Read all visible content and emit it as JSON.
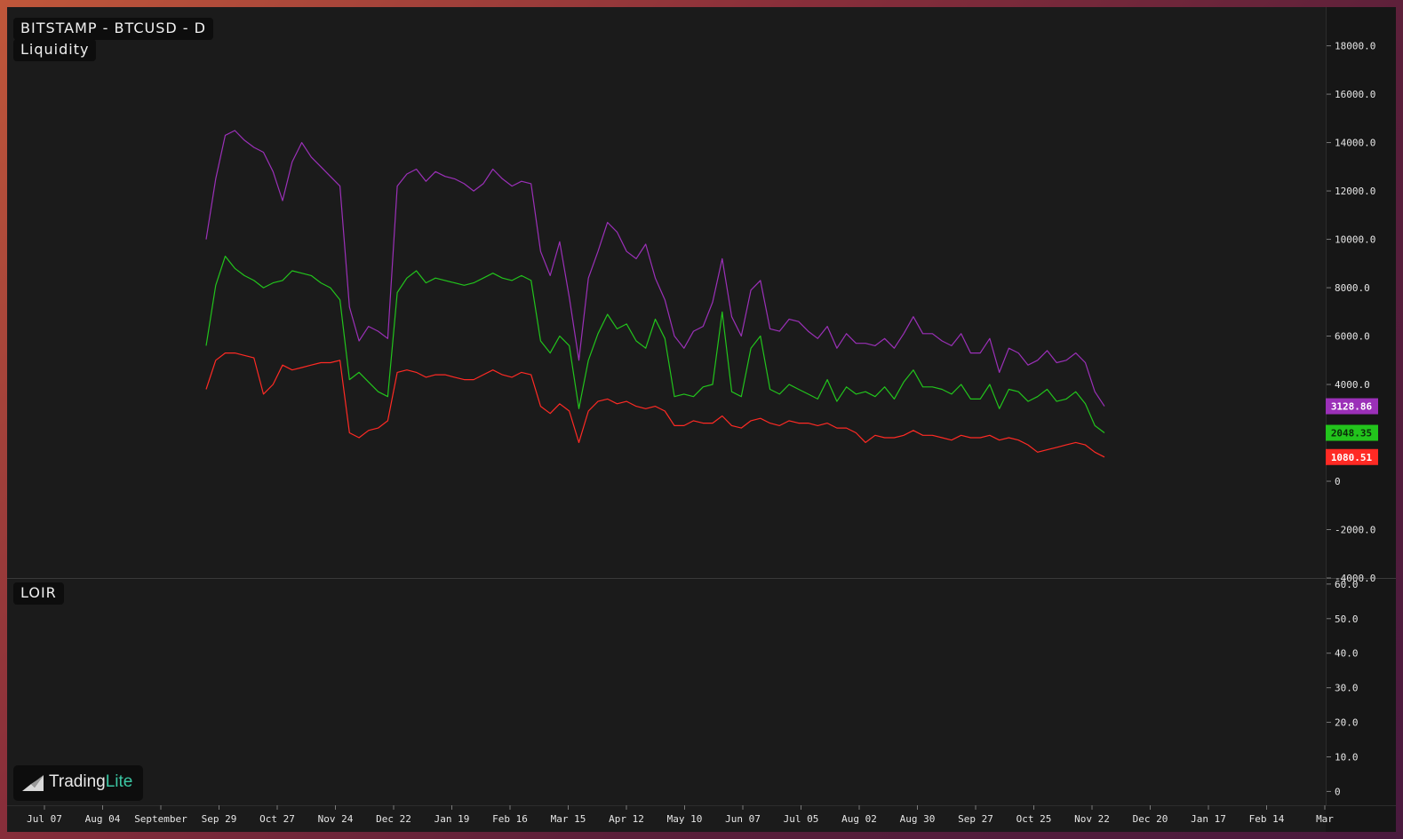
{
  "header": {
    "symbol_title": "BITSTAMP - BTCUSD - D",
    "indicator_title": "Liquidity",
    "lower_indicator_title": "LOIR"
  },
  "logo": {
    "name_part1": "Trading",
    "name_part2": "Lite",
    "accent_color": "#3bc6a3"
  },
  "chart_data": {
    "type": "line",
    "upper_pane": {
      "y_ticks": [
        "18000.0",
        "16000.0",
        "14000.0",
        "12000.0",
        "10000.0",
        "8000.0",
        "6000.0",
        "4000.0",
        "0",
        "-2000.0",
        "-4000.0"
      ],
      "y_tick_values": [
        18000,
        16000,
        14000,
        12000,
        10000,
        8000,
        6000,
        4000,
        0,
        -2000,
        -4000
      ],
      "ylim": [
        -4000,
        19600
      ],
      "series": [
        {
          "color": "#9b30b8",
          "last_value_label": "3128.86",
          "values": [
            10000,
            12500,
            14300,
            14500,
            14100,
            13800,
            13600,
            12800,
            11600,
            13200,
            14000,
            13400,
            13000,
            12600,
            12200,
            7200,
            5800,
            6400,
            6200,
            5900,
            12200,
            12700,
            12900,
            12400,
            12800,
            12600,
            12500,
            12300,
            12000,
            12300,
            12900,
            12500,
            12200,
            12400,
            12300,
            9500,
            8500,
            9900,
            7600,
            5000,
            8400,
            9500,
            10700,
            10300,
            9500,
            9200,
            9800,
            8400,
            7500,
            6000,
            5500,
            6200,
            6400,
            7400,
            9200,
            6800,
            6000,
            7900,
            8300,
            6300,
            6200,
            6700,
            6600,
            6200,
            5900,
            6400,
            5500,
            6100,
            5700,
            5700,
            5600,
            5900,
            5500,
            6100,
            6800,
            6100,
            6100,
            5800,
            5600,
            6100,
            5300,
            5300,
            5900,
            4500,
            5500,
            5300,
            4800,
            5000,
            5400,
            4900,
            5000,
            5300,
            4900,
            3700,
            3100
          ]
        },
        {
          "color": "#22c41c",
          "last_value_label": "2048.35",
          "values": [
            5600,
            8100,
            9300,
            8800,
            8500,
            8300,
            8000,
            8200,
            8300,
            8700,
            8600,
            8500,
            8200,
            8000,
            7500,
            4200,
            4500,
            4100,
            3700,
            3500,
            7800,
            8400,
            8700,
            8200,
            8400,
            8300,
            8200,
            8100,
            8200,
            8400,
            8600,
            8400,
            8300,
            8500,
            8300,
            5800,
            5300,
            6000,
            5600,
            3000,
            5000,
            6100,
            6900,
            6300,
            6500,
            5800,
            5500,
            6700,
            5900,
            3500,
            3600,
            3500,
            3900,
            4000,
            7000,
            3700,
            3500,
            5500,
            6000,
            3800,
            3600,
            4000,
            3800,
            3600,
            3400,
            4200,
            3300,
            3900,
            3600,
            3700,
            3500,
            3900,
            3400,
            4100,
            4600,
            3900,
            3900,
            3800,
            3600,
            4000,
            3400,
            3400,
            4000,
            3000,
            3800,
            3700,
            3300,
            3500,
            3800,
            3300,
            3400,
            3700,
            3200,
            2300,
            2000
          ]
        },
        {
          "color": "#ff2a24",
          "last_value_label": "1080.51",
          "values": [
            3800,
            5000,
            5300,
            5300,
            5200,
            5100,
            3600,
            4000,
            4800,
            4600,
            4700,
            4800,
            4900,
            4900,
            5000,
            2000,
            1800,
            2100,
            2200,
            2500,
            4500,
            4600,
            4500,
            4300,
            4400,
            4400,
            4300,
            4200,
            4200,
            4400,
            4600,
            4400,
            4300,
            4500,
            4400,
            3100,
            2800,
            3200,
            2900,
            1600,
            2900,
            3300,
            3400,
            3200,
            3300,
            3100,
            3000,
            3100,
            2900,
            2300,
            2300,
            2500,
            2400,
            2400,
            2700,
            2300,
            2200,
            2500,
            2600,
            2400,
            2300,
            2500,
            2400,
            2400,
            2300,
            2400,
            2200,
            2200,
            2000,
            1600,
            1900,
            1800,
            1800,
            1900,
            2100,
            1900,
            1900,
            1800,
            1700,
            1900,
            1800,
            1800,
            1900,
            1700,
            1800,
            1700,
            1500,
            1200,
            1300,
            1400,
            1500,
            1600,
            1500,
            1200,
            1000
          ]
        }
      ]
    },
    "lower_pane": {
      "y_ticks": [
        "60.0",
        "50.0",
        "40.0",
        "30.0",
        "20.0",
        "10.0",
        "0"
      ],
      "y_tick_values": [
        60,
        50,
        40,
        30,
        20,
        10,
        0
      ],
      "ylim": [
        -4,
        61.5
      ]
    },
    "x_tick_labels": [
      "Jul 07",
      "Aug 04",
      "September",
      "Sep 29",
      "Oct 27",
      "Nov 24",
      "Dec 22",
      "Jan 19",
      "Feb 16",
      "Mar 15",
      "Apr 12",
      "May 10",
      "Jun 07",
      "Jul 05",
      "Aug 02",
      "Aug 30",
      "Sep 27",
      "Oct 25",
      "Nov 22",
      "Dec 20",
      "Jan 17",
      "Feb 14",
      "Mar"
    ]
  }
}
